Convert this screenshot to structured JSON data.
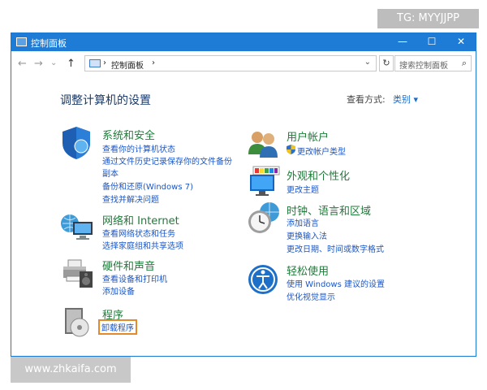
{
  "window": {
    "title": "控制面板",
    "minimize": "—",
    "maximize": "☐",
    "close": "✕"
  },
  "nav": {
    "back": "←",
    "forward": "→",
    "recent": "⌄",
    "up": "↑",
    "breadcrumb": "控制面板",
    "sep1": "›",
    "sep2": "›",
    "dropdown": "⌄",
    "refresh": "↻",
    "search_placeholder": "搜索控制面板",
    "search_icon": "⌕"
  },
  "main": {
    "heading": "调整计算机的设置",
    "view_by_label": "查看方式:",
    "view_by_value": "类别 ▾"
  },
  "categories": [
    {
      "icon": "shield-icon",
      "title": "系统和安全",
      "links": [
        "查看你的计算机状态",
        "通过文件历史记录保存你的文件备份",
        "副本",
        "备份和还原(Windows 7)",
        "查找并解决问题"
      ]
    },
    {
      "icon": "network-icon",
      "title": "网络和 Internet",
      "links": [
        "查看网络状态和任务",
        "选择家庭组和共享选项"
      ]
    },
    {
      "icon": "printer-icon",
      "title": "硬件和声音",
      "links": [
        "查看设备和打印机",
        "添加设备"
      ]
    },
    {
      "icon": "programs-icon",
      "title": "程序",
      "links": [
        "卸载程序"
      ]
    },
    {
      "icon": "users-icon",
      "title": "用户帐户",
      "links": [
        "更改帐户类型"
      ]
    },
    {
      "icon": "display-icon",
      "title": "外观和个性化",
      "links": [
        "更改主题"
      ]
    },
    {
      "icon": "clock-globe-icon",
      "title": "时钟、语言和区域",
      "links": [
        "添加语言",
        "更换输入法",
        "更改日期、时间或数字格式"
      ]
    },
    {
      "icon": "ease-of-access-icon",
      "title": "轻松使用",
      "links": [
        "使用 Windows 建议的设置",
        "优化视觉显示"
      ]
    }
  ],
  "watermarks": {
    "top_right": "TG: MYYJJPP",
    "bottom_left": "www.zhkaifa.com"
  },
  "colors": {
    "titlebar": "#1e7bd6",
    "category_title": "#1f7b3a",
    "link": "#1a56c7",
    "highlight": "#e58a2b"
  }
}
